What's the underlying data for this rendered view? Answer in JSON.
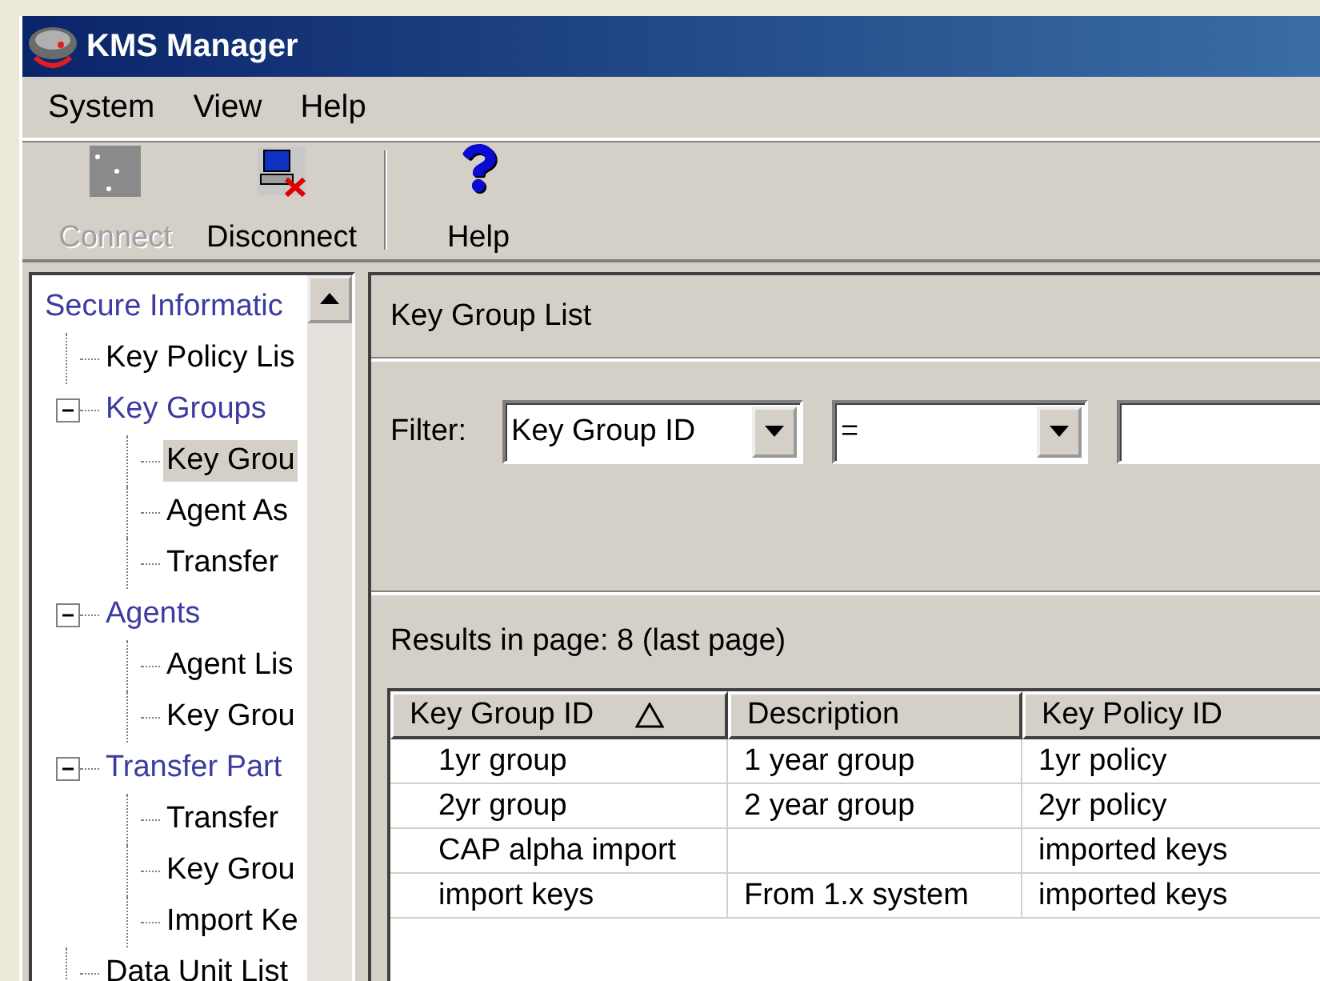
{
  "window": {
    "title": "KMS Manager"
  },
  "menu": [
    {
      "label": "System"
    },
    {
      "label": "View"
    },
    {
      "label": "Help"
    }
  ],
  "toolbar": [
    {
      "label": "Connect",
      "kind": "connect",
      "disabled": true
    },
    {
      "label": "Disconnect",
      "kind": "disconnect",
      "disabled": false
    },
    {
      "label": "Help",
      "kind": "help",
      "disabled": false
    }
  ],
  "tree": [
    {
      "label": "Secure Informatic",
      "kind": "category",
      "selected": false,
      "children": [
        {
          "label": "Key Policy Lis",
          "kind": "leaf",
          "selected": false
        },
        {
          "label": "Key Groups",
          "kind": "category",
          "expanded": true,
          "selected": false,
          "children": [
            {
              "label": "Key Grou",
              "kind": "leaf",
              "selected": true
            },
            {
              "label": "Agent As",
              "kind": "leaf",
              "selected": false
            },
            {
              "label": "Transfer",
              "kind": "leaf",
              "selected": false
            }
          ]
        },
        {
          "label": "Agents",
          "kind": "category",
          "expanded": true,
          "selected": false,
          "children": [
            {
              "label": "Agent Lis",
              "kind": "leaf",
              "selected": false
            },
            {
              "label": "Key Grou",
              "kind": "leaf",
              "selected": false
            }
          ]
        },
        {
          "label": "Transfer Part",
          "kind": "category",
          "expanded": true,
          "selected": false,
          "children": [
            {
              "label": "Transfer",
              "kind": "leaf",
              "selected": false
            },
            {
              "label": "Key Grou",
              "kind": "leaf",
              "selected": false
            },
            {
              "label": "Import Ke",
              "kind": "leaf",
              "selected": false
            }
          ]
        },
        {
          "label": "Data Unit List",
          "kind": "leaf",
          "selected": false
        }
      ]
    }
  ],
  "panel": {
    "title": "Key Group List",
    "filter": {
      "label": "Filter:",
      "selects": [
        {
          "value": "Key Group ID"
        },
        {
          "value": "="
        }
      ]
    },
    "results": "Results in page: 8 (last page)",
    "table": {
      "columns": [
        {
          "label": "Key Group ID",
          "sorted": true
        },
        {
          "label": "Description",
          "sorted": false
        },
        {
          "label": "Key Policy ID",
          "sorted": false
        }
      ],
      "rows": [
        [
          "1yr group",
          "1 year group",
          "1yr policy"
        ],
        [
          "2yr group",
          "2 year group",
          "2yr policy"
        ],
        [
          "CAP alpha import",
          "",
          "imported keys"
        ],
        [
          "import keys",
          "From 1.x system",
          "imported keys"
        ]
      ]
    }
  }
}
